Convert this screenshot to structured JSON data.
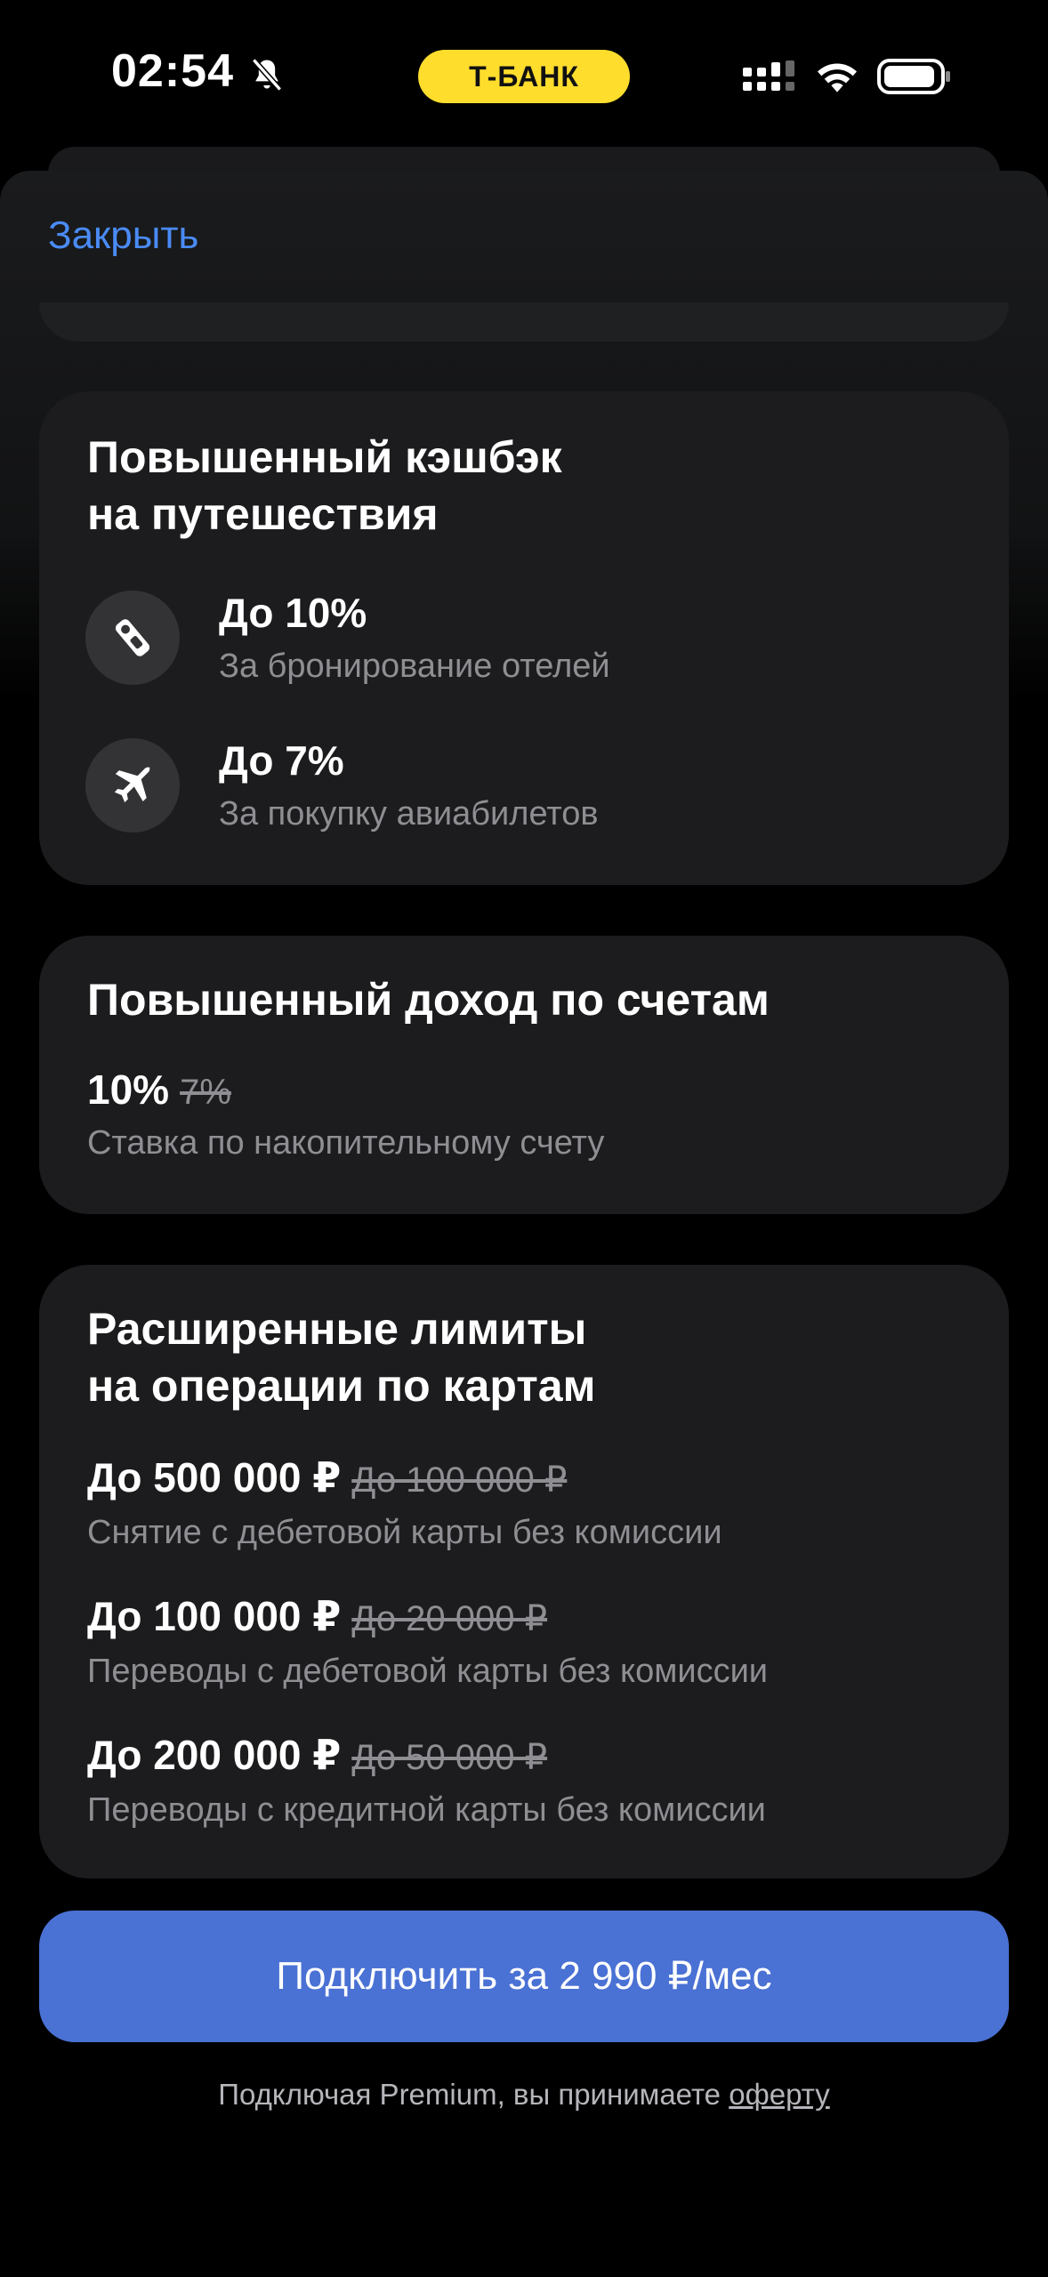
{
  "status_bar": {
    "time": "02:54",
    "carrier_pill": "Т-БАНК",
    "icons": [
      "bell-slash-icon",
      "signal-icon",
      "wifi-icon",
      "battery-icon"
    ]
  },
  "header": {
    "close_label": "Закрыть"
  },
  "travel_card": {
    "title_line1": "Повышенный кэшбэк",
    "title_line2": "на путешествия",
    "items": [
      {
        "icon": "hotel-tag-icon",
        "value": "До 10%",
        "description": "За бронирование отелей"
      },
      {
        "icon": "airplane-icon",
        "value": "До 7%",
        "description": "За покупку авиабилетов"
      }
    ]
  },
  "income_card": {
    "title": "Повышенный доход по счетам",
    "value": "10%",
    "old_value": "7%",
    "description": "Ставка по накопительному счету"
  },
  "limits_card": {
    "title_line1": "Расширенные лимиты",
    "title_line2": "на операции по картам",
    "items": [
      {
        "value": "До 500 000 ₽",
        "old_value": "До 100 000 ₽",
        "description": "Снятие с дебетовой карты без комиссии"
      },
      {
        "value": "До 100 000 ₽",
        "old_value": "До 20 000 ₽",
        "description": "Переводы с дебетовой карты без комиссии"
      },
      {
        "value": "До 200 000 ₽",
        "old_value": "До 50 000 ₽",
        "description": "Переводы с кредитной карты без комиссии"
      }
    ]
  },
  "cta": {
    "label": "Подключить за 2 990 ₽/мес"
  },
  "footer": {
    "text": "Подключая Premium, вы принимаете",
    "link": "оферту"
  },
  "colors": {
    "accent_link": "#4a8bf5",
    "cta_bg": "#4a71d4",
    "pill_bg": "#ffdd2d",
    "card_bg": "#1c1c1e"
  }
}
